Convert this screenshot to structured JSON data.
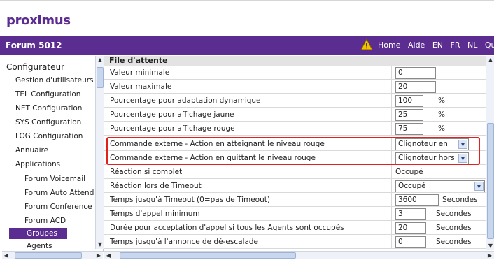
{
  "logo": {
    "text_pre": "pro",
    "text_x": "x",
    "text_post": "imus"
  },
  "header": {
    "title": "Forum 5012",
    "links": [
      "Home",
      "Aide",
      "EN",
      "FR",
      "NL",
      "Quitter"
    ]
  },
  "sidebar": {
    "root": "Configurateur",
    "items": [
      "Gestion d'utilisateurs",
      "TEL Configuration",
      "NET Configuration",
      "SYS Configuration",
      "LOG Configuration",
      "Annuaire",
      "Applications",
      "Forum Voicemail",
      "Forum Auto Attend",
      "Forum Conference",
      "Forum ACD",
      "Groupes",
      "Agents"
    ]
  },
  "main": {
    "section_title": "File d'attente",
    "rows": [
      {
        "label": "Valeur minimale",
        "value": "0",
        "unit": ""
      },
      {
        "label": "Valeur maximale",
        "value": "20",
        "unit": ""
      },
      {
        "label": "Pourcentage pour adaptation dynamique",
        "value": "100",
        "unit": "%"
      },
      {
        "label": "Pourcentage pour affichage jaune",
        "value": "25",
        "unit": "%"
      },
      {
        "label": "Pourcentage pour affichage rouge",
        "value": "75",
        "unit": "%"
      },
      {
        "label": "Commande externe - Action en atteignant le niveau rouge",
        "value": "Clignoteur en",
        "unit": ""
      },
      {
        "label": "Commande externe - Action en quittant le niveau rouge",
        "value": "Clignoteur hors",
        "unit": ""
      },
      {
        "label": "Réaction si complet",
        "value": "Occupé",
        "unit": ""
      },
      {
        "label": "Réaction lors de Timeout",
        "value": "Occupé",
        "unit": ""
      },
      {
        "label": "Temps jusqu'à Timeout (0=pas de Timeout)",
        "value": "3600",
        "unit": "Secondes"
      },
      {
        "label": "Temps d'appel minimum",
        "value": "3",
        "unit": "Secondes"
      },
      {
        "label": "Durée pour acceptation d'appel si tous les Agents sont occupés",
        "value": "20",
        "unit": "Secondes"
      },
      {
        "label": "Temps jusqu'à l'annonce de dé-escalade",
        "value": "0",
        "unit": "Secondes"
      }
    ]
  },
  "colors": {
    "brand": "#5c2d91",
    "highlight": "#e0211d"
  }
}
